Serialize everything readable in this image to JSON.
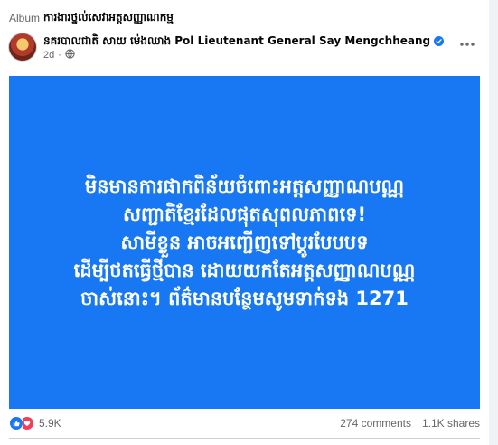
{
  "album": {
    "label": "Album",
    "title": "ការងារថ្នល់សេវាអត្តសញ្ញាណកម្ម"
  },
  "post": {
    "author": "នគរបាលជាតិ សាយ ម៉េងឈាង Pol Lieutenant General Say Mengchheang",
    "time": "2d",
    "audience_icon": "globe-icon",
    "lines": [
      "មិនមានការផាកពិន័យចំពោះអត្តសញ្ញាណបណ្ណ",
      "សញ្ជាតិខ្មែរដែលផុតសុពលភាពទេ!",
      "សាមីខ្លួន អាចអញ្ជើញទៅប្តូរបែបបទ",
      "ដើម្បីថតធ្វើថ្មីបាន ដោយយកតែអត្តសញ្ញាណបណ្ណ",
      "ចាស់នោះ។ ព័ត៌មានបន្ថែមសូមទាក់ទង 1271"
    ],
    "background_color": "#1877f2"
  },
  "stats": {
    "reaction_count": "5.9K",
    "reaction_icons": [
      "like-icon",
      "love-icon"
    ],
    "comments": "274 comments",
    "shares": "1.1K shares"
  },
  "colors": {
    "accent": "#1877f2",
    "love": "#f33e58",
    "muted_text": "#65676b"
  }
}
